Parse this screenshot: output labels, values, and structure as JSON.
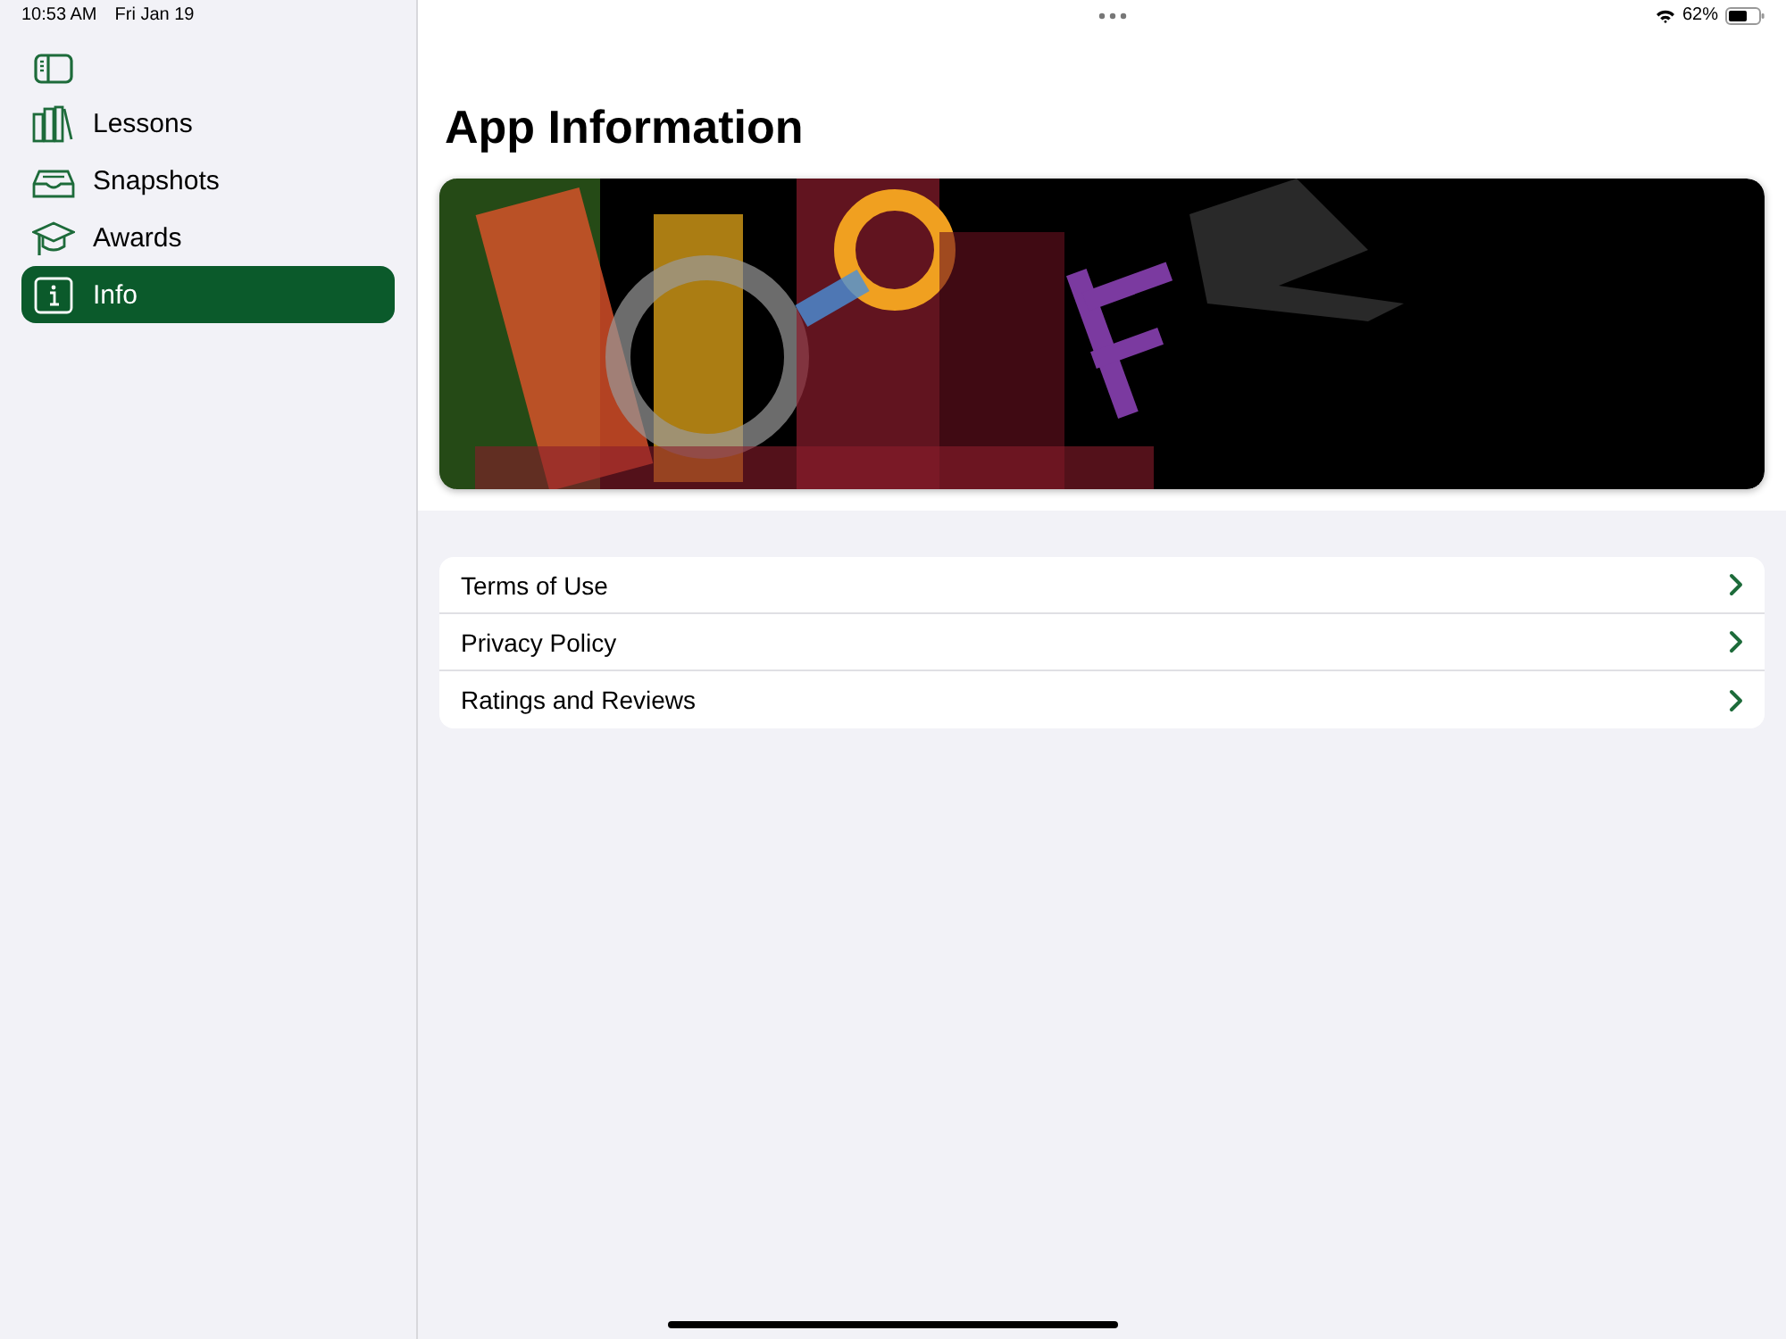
{
  "status_bar": {
    "time": "10:53 AM",
    "date": "Fri Jan 19",
    "battery": "62%"
  },
  "sidebar": {
    "items": [
      {
        "label": "Lessons",
        "selected": false
      },
      {
        "label": "Snapshots",
        "selected": false
      },
      {
        "label": "Awards",
        "selected": false
      },
      {
        "label": "Info",
        "selected": true
      }
    ]
  },
  "page": {
    "title": "App Information"
  },
  "links": [
    {
      "label": "Terms of Use"
    },
    {
      "label": "Privacy Policy"
    },
    {
      "label": "Ratings and Reviews"
    }
  ]
}
